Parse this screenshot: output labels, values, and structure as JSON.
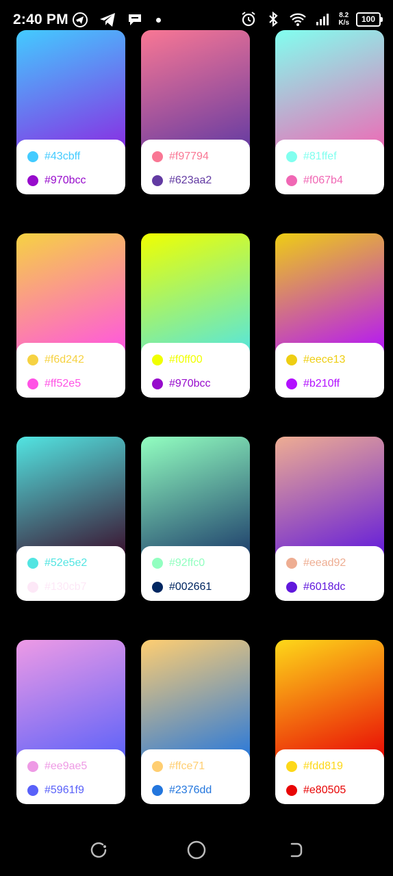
{
  "status": {
    "time": "2:40 PM",
    "net_speed_value": "8.2",
    "net_speed_unit": "K/s",
    "battery": "100"
  },
  "cards": [
    {
      "color1": "#43cbff",
      "color2": "#970bcc",
      "label1": "#43cbff",
      "label2": "#970bcc"
    },
    {
      "color1": "#f97794",
      "color2": "#623aa2",
      "label1": "#f97794",
      "label2": "#623aa2"
    },
    {
      "color1": "#81ffef",
      "color2": "#f067b4",
      "label1": "#81ffef",
      "label2": "#f067b4"
    },
    {
      "color1": "#f6d242",
      "color2": "#ff52e5",
      "label1": "#f6d242",
      "label2": "#ff52e5"
    },
    {
      "color1": "#f0ff00",
      "color2": "#970bcc",
      "label1": "#f0ff00",
      "label2": "#970bcc"
    },
    {
      "color1": "#eece13",
      "color2": "#b210ff",
      "label1": "#eece13",
      "label2": "#b210ff"
    },
    {
      "color1": "#52e5e2",
      "color2": "#fde8f7",
      "label1": "#52e5e2",
      "label2": "#130cb7"
    },
    {
      "color1": "#92ffc0",
      "color2": "#002661",
      "label1": "#92ffc0",
      "label2": "#002661"
    },
    {
      "color1": "#eead92",
      "color2": "#6018dc",
      "label1": "#eead92",
      "label2": "#6018dc"
    },
    {
      "color1": "#ee9ae5",
      "color2": "#5961f9",
      "label1": "#ee9ae5",
      "label2": "#5961f9"
    },
    {
      "color1": "#ffce71",
      "color2": "#2376dd",
      "label1": "#ffce71",
      "label2": "#2376dd"
    },
    {
      "color1": "#fdd819",
      "color2": "#e80505",
      "label1": "#fdd819",
      "label2": "#e80505"
    }
  ],
  "swatch_bottom_colors": [
    "#8a2be2",
    "#623aa2",
    "#f067b4",
    "#ff52e5",
    "#52e5e2",
    "#b210ff",
    "#3a0c2a",
    "#1c3a6a",
    "#6018dc",
    "#5961f9",
    "#2376dd",
    "#e80505"
  ]
}
